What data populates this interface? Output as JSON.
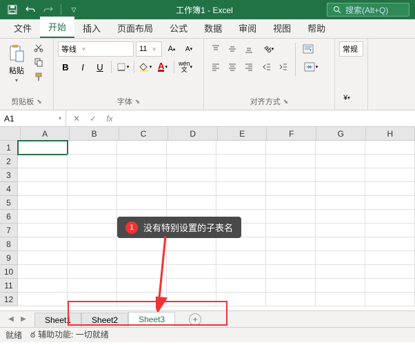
{
  "titlebar": {
    "title": "工作簿1  -  Excel",
    "search_placeholder": "搜索(Alt+Q)"
  },
  "tabs": {
    "items": [
      "文件",
      "开始",
      "插入",
      "页面布局",
      "公式",
      "数据",
      "审阅",
      "视图",
      "帮助"
    ],
    "active": 1
  },
  "ribbon": {
    "clipboard": {
      "label": "剪贴板",
      "paste": "粘贴"
    },
    "font": {
      "label": "字体",
      "name": "等线",
      "size": "11",
      "bold": "B",
      "italic": "I",
      "underline": "U"
    },
    "align": {
      "label": "对齐方式"
    },
    "format": {
      "label": "常规"
    }
  },
  "formula_bar": {
    "cell_ref": "A1",
    "fx": "fx"
  },
  "grid": {
    "columns": [
      "A",
      "B",
      "C",
      "D",
      "E",
      "F",
      "G",
      "H"
    ],
    "rows": [
      "1",
      "2",
      "3",
      "4",
      "5",
      "6",
      "7",
      "8",
      "9",
      "10",
      "11",
      "12"
    ],
    "active_cell": "A1"
  },
  "sheets": {
    "items": [
      "Sheet1",
      "Sheet2",
      "Sheet3"
    ],
    "active": 2
  },
  "status": {
    "ready": "就绪",
    "accessibility": "辅助功能: 一切就绪"
  },
  "annotation": {
    "num": "1",
    "text": "没有特别设置的子表名"
  }
}
